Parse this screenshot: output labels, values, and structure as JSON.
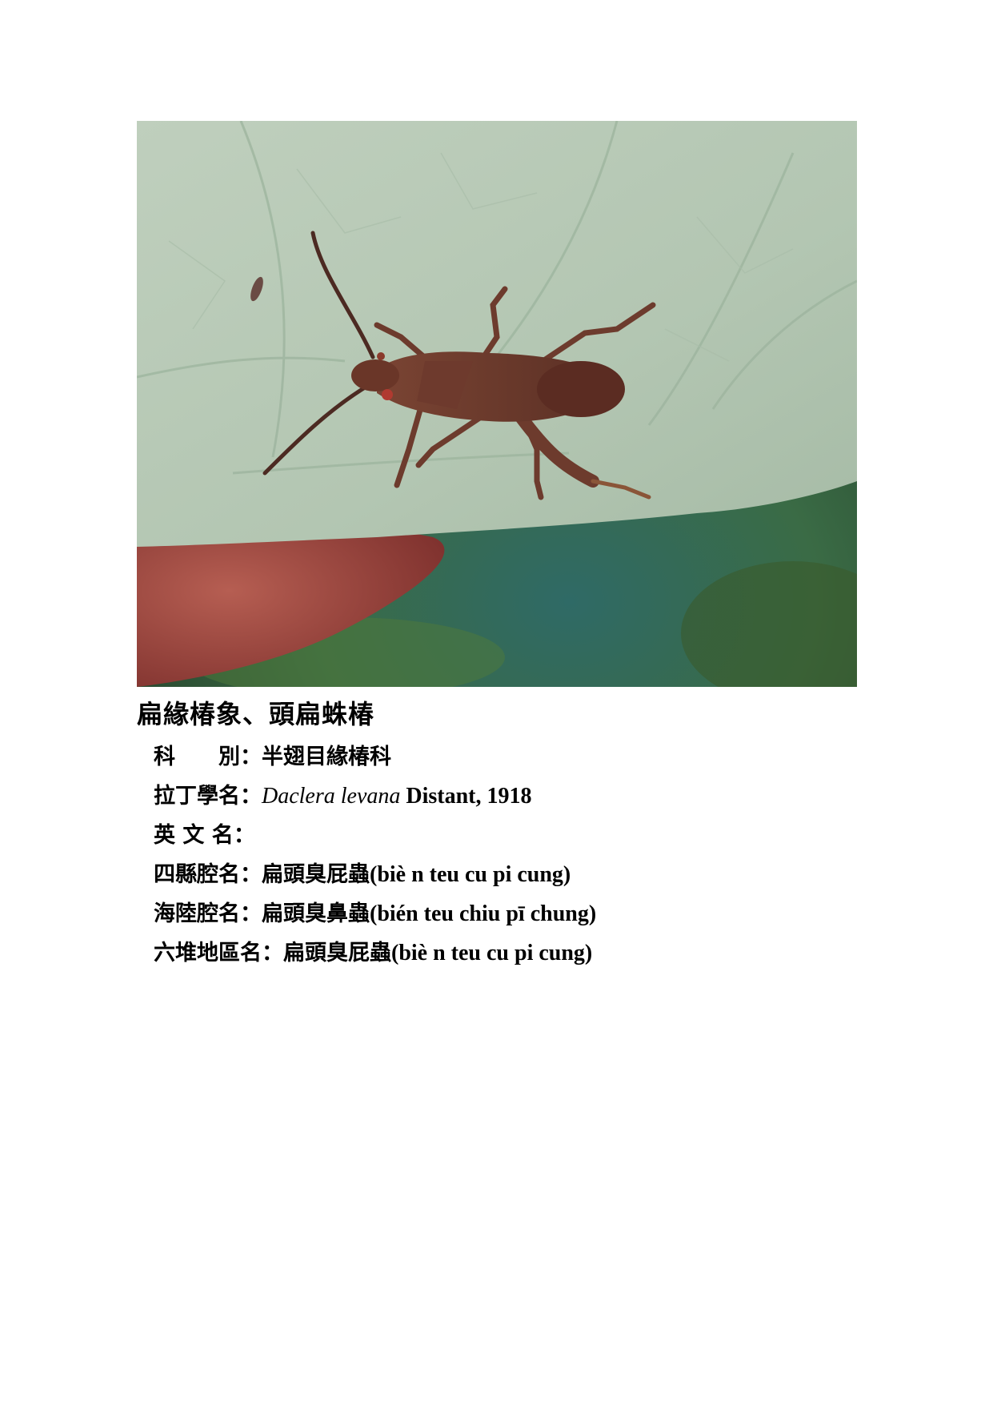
{
  "species": {
    "title": "扁緣椿象、頭扁蛛椿",
    "fields": [
      {
        "label": "科　　別",
        "value": "半翅目緣椿科"
      },
      {
        "label": "拉丁學名",
        "value_italic": "Daclera levana",
        "value": " Distant, 1918"
      },
      {
        "label": "英 文 名",
        "value": ""
      },
      {
        "label": "四縣腔名",
        "value_cn": "扁頭臭屁蟲",
        "value_roman": "(biè n teu cu pi cung)"
      },
      {
        "label": "海陸腔名",
        "value_cn": "扁頭臭鼻蟲",
        "value_roman": "(bién teu chiu pī chung)"
      },
      {
        "label": "六堆地區名",
        "value_cn": "扁頭臭屁蟲",
        "value_roman": "(biè n teu cu pi cung)"
      }
    ],
    "separator": "："
  },
  "photo": {
    "subject": "leaf-footed bug on leaf",
    "colors": {
      "leaf": "#b6c9b5",
      "bug": "#6b3a2c",
      "finger": "#a55148",
      "background": "#3f6a52"
    }
  }
}
